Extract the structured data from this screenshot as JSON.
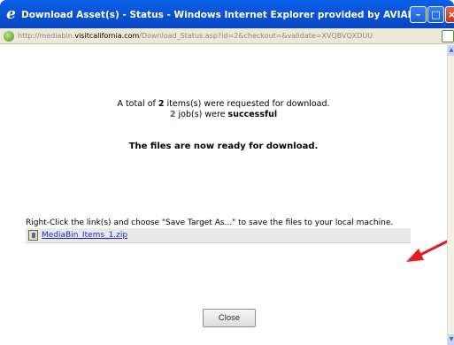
{
  "window": {
    "title": "Download Asset(s) - Status - Windows Internet Explorer provided by AVIAREPS AG",
    "min_glyph": "–",
    "max_glyph": "□",
    "close_glyph": "×"
  },
  "address": {
    "url_prefix": "http://mediabin.",
    "url_domain": "visitcalifornia.com",
    "url_suffix": "/Download_Status.asp?id=2&checkout=&validate=XVQBVQXDUU"
  },
  "status": {
    "line1_prefix": "A total of ",
    "total_count": "2",
    "line1_suffix": " items(s) were requested for download.",
    "success_count": "2",
    "line2_middle": " job(s) were ",
    "line2_bold": "successful",
    "ready_message": "The files are now ready for download."
  },
  "download": {
    "instructions": "Right-Click the link(s) and choose \"Save Target As...\" to save the files to your local machine.",
    "link_label": "MediaBin_Items_1.zip",
    "icon": "zip-file-icon"
  },
  "footer": {
    "close_label": "Close"
  },
  "colors": {
    "titlebar": "#0b53d6",
    "link": "#1a2bc5",
    "success": "#2a8a2a",
    "annotation_arrow": "#e02020"
  }
}
